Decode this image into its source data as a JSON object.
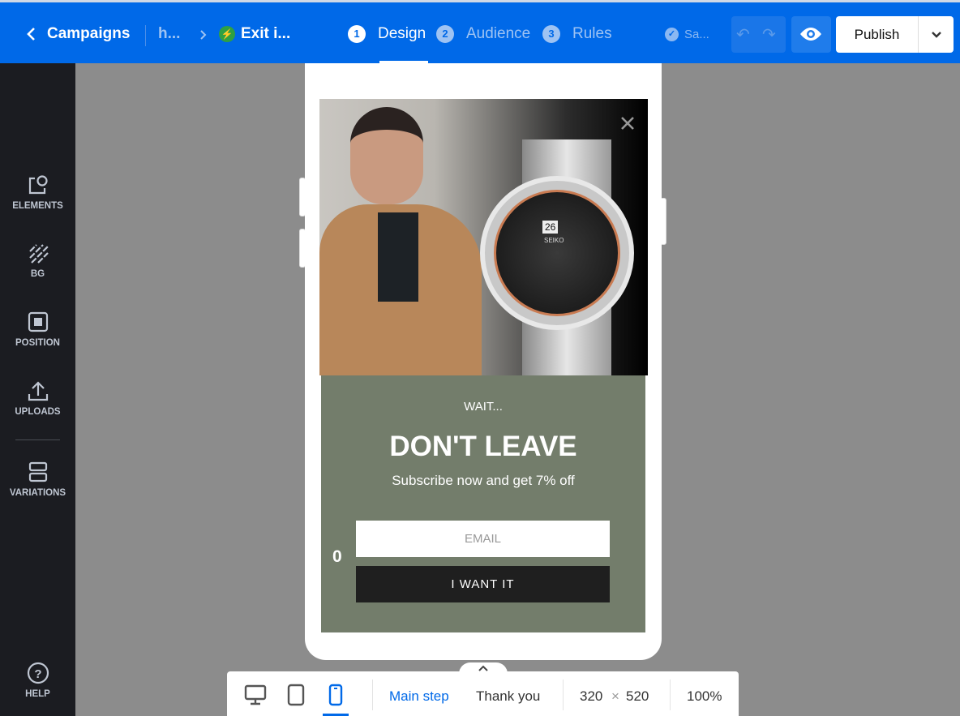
{
  "header": {
    "back_label": "Campaigns",
    "breadcrumb_1": "h...",
    "campaign_name": "Exit i...",
    "steps": [
      {
        "num": "1",
        "label": "Design"
      },
      {
        "num": "2",
        "label": "Audience"
      },
      {
        "num": "3",
        "label": "Rules"
      }
    ],
    "save_status": "Sa...",
    "publish_label": "Publish"
  },
  "sidebar": {
    "items": [
      {
        "label": "ELEMENTS",
        "icon": "elements-icon"
      },
      {
        "label": "BG",
        "icon": "background-icon"
      },
      {
        "label": "POSITION",
        "icon": "position-icon"
      },
      {
        "label": "UPLOADS",
        "icon": "upload-icon"
      },
      {
        "label": "VARIATIONS",
        "icon": "variations-icon"
      }
    ],
    "help_label": "HELP"
  },
  "popup": {
    "eyebrow": "WAIT...",
    "headline": "DON'T LEAVE",
    "subtext": "Subscribe now and get 7% off",
    "email_placeholder": "EMAIL",
    "cta_label": "I WANT IT",
    "side_counter": "0",
    "watch_brand": "SEIKO",
    "watch_date": "26"
  },
  "toolbar": {
    "steps": [
      "Main step",
      "Thank you"
    ],
    "width": "320",
    "height": "520",
    "size_sep": "×",
    "zoom": "100%"
  },
  "colors": {
    "accent": "#0069e8",
    "panel": "#737d6b",
    "cta": "#1f1f1f"
  }
}
